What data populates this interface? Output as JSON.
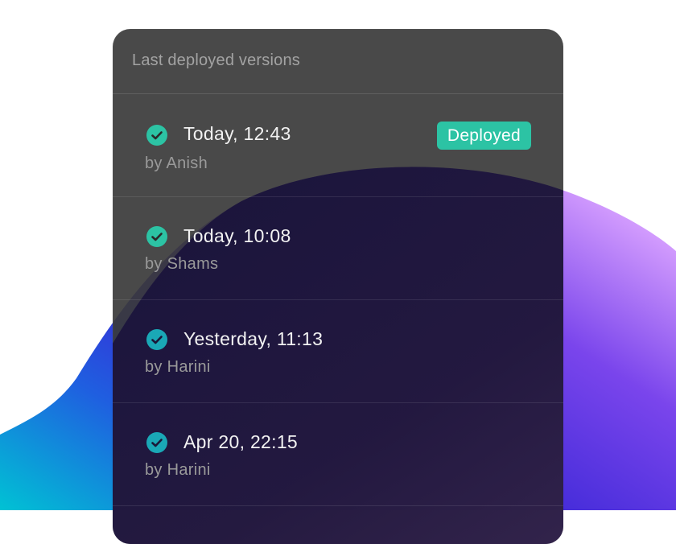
{
  "colors": {
    "accent": "#2cc3a4",
    "panel_bg": "#3a3a3a",
    "blob_cyan": "#00b8d9",
    "blob_blue": "#3a2fe0",
    "blob_purple": "#8a4cf0",
    "blob_pink": "#d39bff"
  },
  "panel": {
    "title": "Last deployed versions"
  },
  "deployments": [
    {
      "time": "Today, 12:43",
      "author": "by Anish",
      "badge": "Deployed",
      "status_icon": "check-circle-icon"
    },
    {
      "time": "Today, 10:08",
      "author": "by Shams",
      "status_icon": "check-circle-icon"
    },
    {
      "time": "Yesterday, 11:13",
      "author": "by Harini",
      "status_icon": "check-circle-icon"
    },
    {
      "time": "Apr 20, 22:15",
      "author": "by Harini",
      "status_icon": "check-circle-icon"
    }
  ]
}
